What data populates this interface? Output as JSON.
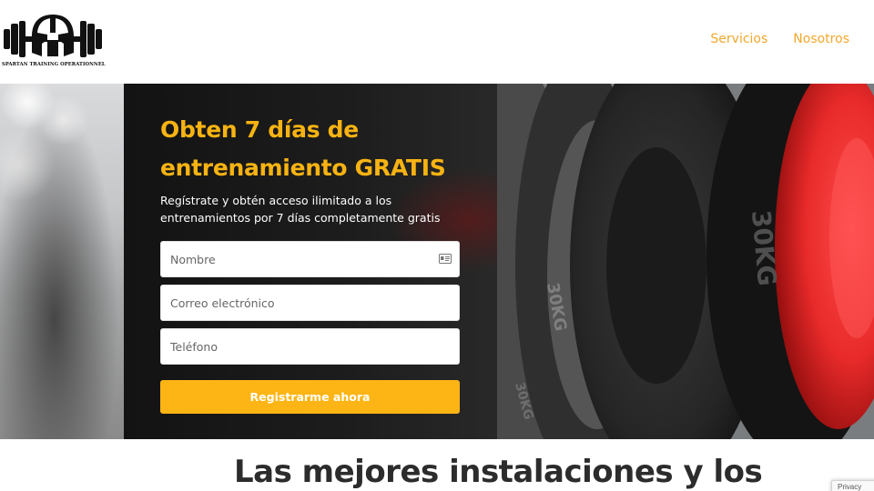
{
  "header": {
    "logo_caption": "SPARTAN TRAINING OPERATIONNEL",
    "nav": [
      {
        "label": "Servicios"
      },
      {
        "label": "Nosotros"
      }
    ]
  },
  "hero": {
    "title_line1": "Obten 7 días de",
    "title_line2": "entrenamiento GRATIS",
    "subtitle": "Regístrate y obtén acceso ilimitado a los entrenamientos por 7 días completamente gratis",
    "plate_label": "30KG"
  },
  "form": {
    "name_placeholder": "Nombre",
    "email_placeholder": "Correo electrónico",
    "phone_placeholder": "Teléfono",
    "submit_label": "Registrarme ahora"
  },
  "section": {
    "heading": "Las mejores instalaciones y los"
  },
  "recaptcha": {
    "label": "Privacy"
  },
  "colors": {
    "accent": "#f7b312",
    "nav_text": "#f2a72c",
    "button": "#fdb515",
    "overlay": "#1c1c1c"
  },
  "icons": {
    "name_field": "contact-card-icon",
    "logo": "spartan-helmet-dumbbell-icon"
  }
}
